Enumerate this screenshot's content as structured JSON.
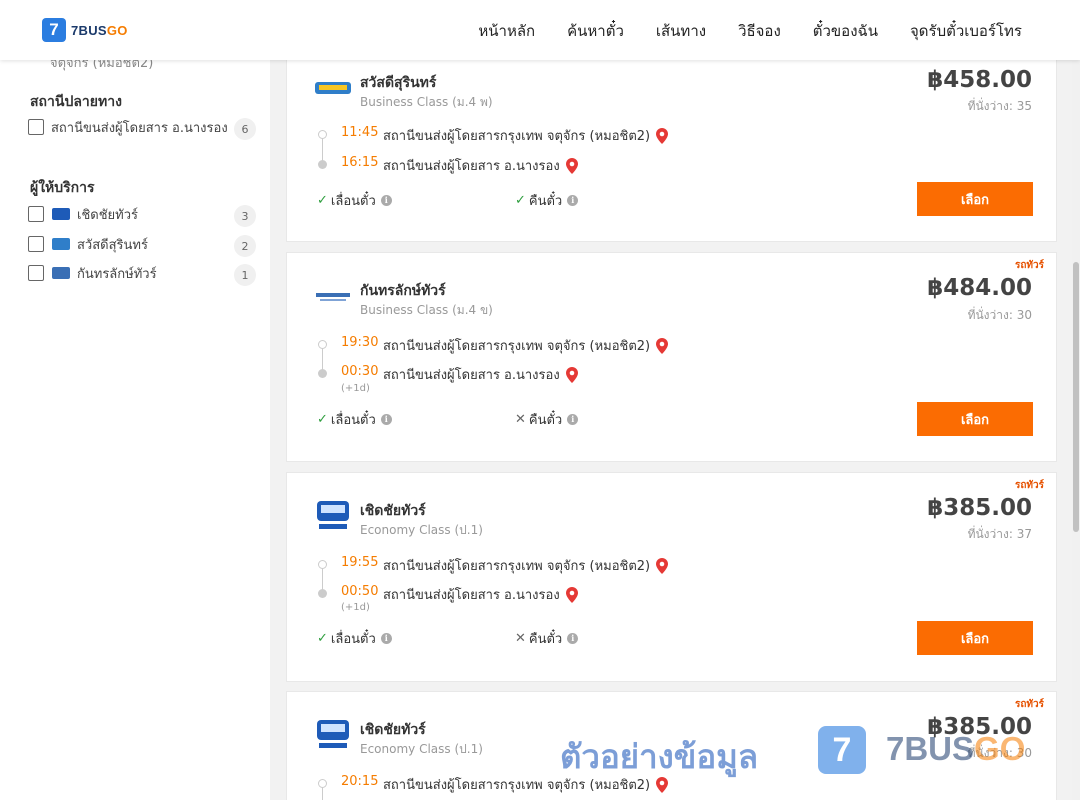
{
  "header": {
    "logo_number": "7",
    "logo_text_main": "7BUS",
    "logo_text_accent": "GO",
    "nav": [
      "หน้าหลัก",
      "ค้นหาตั๋ว",
      "เส้นทาง",
      "วิธีจอง",
      "ตั๋วของฉัน",
      "จุดรับตั๋วเบอร์โทร"
    ]
  },
  "sidebar": {
    "cut_text": "จตุจักร (หมอชิต2)",
    "destination_title": "สถานีปลายทาง",
    "destinations": [
      {
        "label": "สถานีขนส่งผู้โดยสาร อ.นางรอง",
        "count": "6"
      }
    ],
    "operator_title": "ผู้ให้บริการ",
    "operators": [
      {
        "label": "เชิดชัยทัวร์",
        "count": "3",
        "logo_color": "#1e5bb8"
      },
      {
        "label": "สวัสดีสุรินทร์",
        "count": "2",
        "logo_color": "#2f7ec9"
      },
      {
        "label": "กันทรลักษ์ทัวร์",
        "count": "1",
        "logo_color": "#3a6fb5"
      }
    ]
  },
  "trips": [
    {
      "tag": "",
      "operator": "สวัสดีสุรินทร์",
      "class": "Business Class (ม.4 พ)",
      "price": "฿458.00",
      "seats": "ที่นั่งว่าง: 35",
      "depart_time": "11:45",
      "depart_station": "สถานีขนส่งผู้โดยสารกรุงเทพ จตุจักร (หมอชิต2)",
      "arrive_time": "16:15",
      "arrive_plus": "",
      "arrive_station": "สถานีขนส่งผู้โดยสาร อ.นางรอง",
      "reschedule": "เลื่อนตั๋ว",
      "reschedule_ok": true,
      "refund": "คืนตั๋ว",
      "refund_ok": true,
      "button": "เลือก"
    },
    {
      "tag": "รถทัวร์",
      "operator": "กันทรลักษ์ทัวร์",
      "class": "Business Class (ม.4 ข)",
      "price": "฿484.00",
      "seats": "ที่นั่งว่าง: 30",
      "depart_time": "19:30",
      "depart_station": "สถานีขนส่งผู้โดยสารกรุงเทพ จตุจักร (หมอชิต2)",
      "arrive_time": "00:30",
      "arrive_plus": "(+1d)",
      "arrive_station": "สถานีขนส่งผู้โดยสาร อ.นางรอง",
      "reschedule": "เลื่อนตั๋ว",
      "reschedule_ok": true,
      "refund": "คืนตั๋ว",
      "refund_ok": false,
      "button": "เลือก"
    },
    {
      "tag": "รถทัวร์",
      "operator": "เชิดชัยทัวร์",
      "class": "Economy Class (ป.1)",
      "price": "฿385.00",
      "seats": "ที่นั่งว่าง: 37",
      "depart_time": "19:55",
      "depart_station": "สถานีขนส่งผู้โดยสารกรุงเทพ จตุจักร (หมอชิต2)",
      "arrive_time": "00:50",
      "arrive_plus": "(+1d)",
      "arrive_station": "สถานีขนส่งผู้โดยสาร อ.นางรอง",
      "reschedule": "เลื่อนตั๋ว",
      "reschedule_ok": true,
      "refund": "คืนตั๋ว",
      "refund_ok": false,
      "button": "เลือก"
    },
    {
      "tag": "รถทัวร์",
      "operator": "เชิดชัยทัวร์",
      "class": "Economy Class (ป.1)",
      "price": "฿385.00",
      "seats": "ที่นั่งว่าง: 30",
      "depart_time": "20:15",
      "depart_station": "สถานีขนส่งผู้โดยสารกรุงเทพ จตุจักร (หมอชิต2)"
    }
  ],
  "watermark": {
    "text": "ตัวอย่างข้อมูล",
    "badge": "7",
    "brand_main": "7BUS",
    "brand_accent": "GO"
  },
  "colors": {
    "accent_orange": "#fb6c02",
    "time_orange": "#f57c00",
    "brand_blue": "#2b7de0"
  }
}
